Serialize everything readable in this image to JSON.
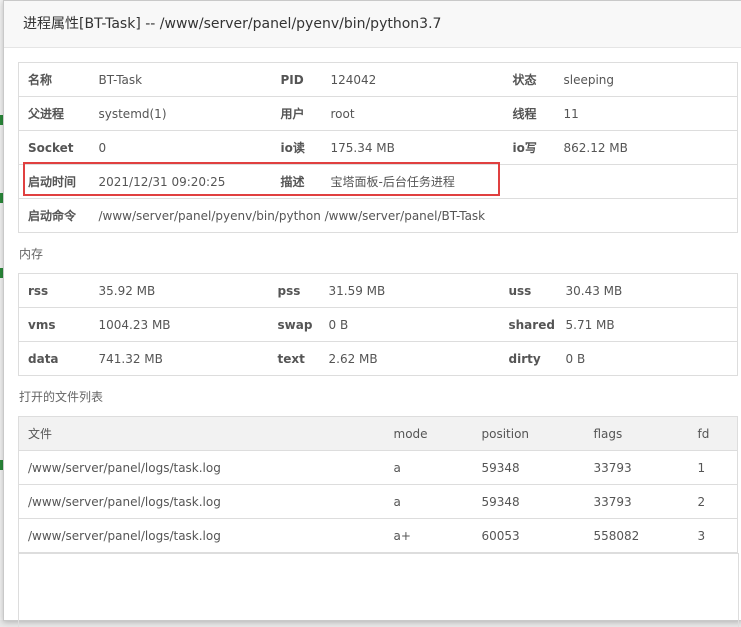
{
  "dialog": {
    "title": "进程属性[BT-Task] -- /www/server/panel/pyenv/bin/python3.7"
  },
  "process_info": {
    "rows": [
      [
        {
          "key": "名称",
          "value": "BT-Task"
        },
        {
          "key": "PID",
          "value": "124042"
        },
        {
          "key": "状态",
          "value": "sleeping"
        }
      ],
      [
        {
          "key": "父进程",
          "value": "systemd(1)"
        },
        {
          "key": "用户",
          "value": "root"
        },
        {
          "key": "线程",
          "value": "11"
        }
      ],
      [
        {
          "key": "Socket",
          "value": "0"
        },
        {
          "key": "io读",
          "value": "175.34 MB"
        },
        {
          "key": "io写",
          "value": "862.12 MB"
        }
      ],
      [
        {
          "key": "启动时间",
          "value": "2021/12/31 09:20:25"
        },
        {
          "key": "描述",
          "value": "宝塔面板-后台任务进程"
        }
      ]
    ],
    "command": {
      "key": "启动命令",
      "value": "/www/server/panel/pyenv/bin/python /www/server/panel/BT-Task"
    }
  },
  "memory": {
    "section_title": "内存",
    "rows": [
      [
        {
          "key": "rss",
          "value": "35.92 MB"
        },
        {
          "key": "pss",
          "value": "31.59 MB"
        },
        {
          "key": "uss",
          "value": "30.43 MB"
        }
      ],
      [
        {
          "key": "vms",
          "value": "1004.23 MB"
        },
        {
          "key": "swap",
          "value": "0 B"
        },
        {
          "key": "shared",
          "value": "5.71 MB"
        }
      ],
      [
        {
          "key": "data",
          "value": "741.32 MB"
        },
        {
          "key": "text",
          "value": "2.62 MB"
        },
        {
          "key": "dirty",
          "value": "0 B"
        }
      ]
    ]
  },
  "open_files": {
    "section_title": "打开的文件列表",
    "columns": [
      "文件",
      "mode",
      "position",
      "flags",
      "fd"
    ],
    "rows": [
      [
        "/www/server/panel/logs/task.log",
        "a",
        "59348",
        "33793",
        "1"
      ],
      [
        "/www/server/panel/logs/task.log",
        "a",
        "59348",
        "33793",
        "2"
      ],
      [
        "/www/server/panel/logs/task.log",
        "a+",
        "60053",
        "558082",
        "3"
      ]
    ]
  },
  "colors": {
    "highlight_border": "#e04040",
    "header_bg": "#f2f2f2",
    "border": "#dddddd"
  }
}
